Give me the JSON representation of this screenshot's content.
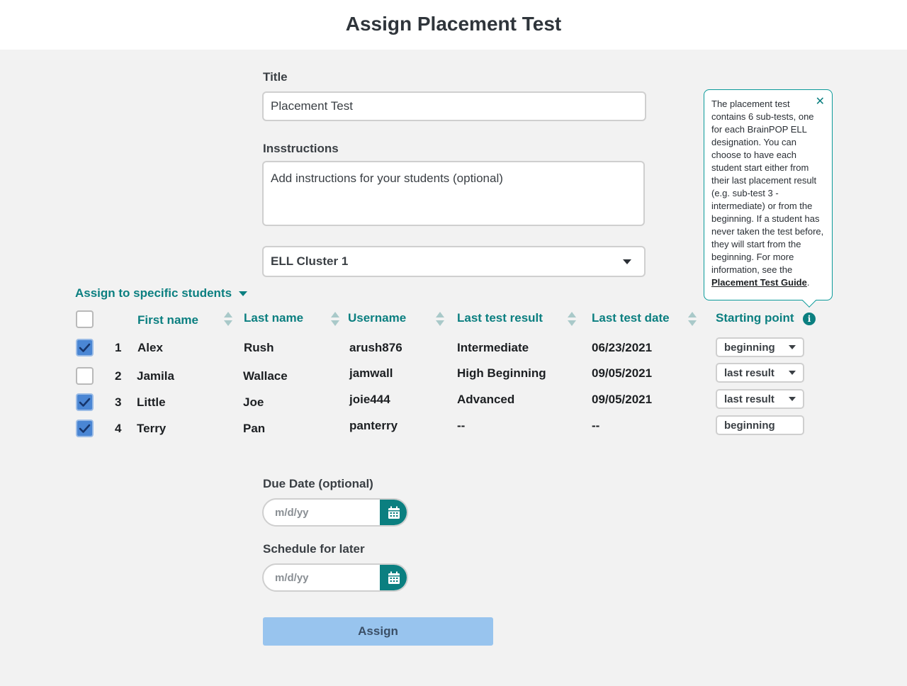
{
  "header": {
    "title": "Assign Placement Test"
  },
  "form": {
    "title_label": "Title",
    "title_value": "Placement Test",
    "instructions_label": "Insstructions",
    "instructions_placeholder": "Add instructions for your students (optional)",
    "cluster_value": "ELL Cluster 1"
  },
  "assign_toggle_label": "Assign to specific students",
  "table": {
    "headers": {
      "first_name": "First name",
      "last_name": "Last name",
      "username": "Username",
      "last_test_result": "Last test result",
      "last_test_date": "Last test date",
      "starting_point": "Starting point"
    },
    "rows": [
      {
        "index": "1",
        "checked": true,
        "first": "Alex",
        "last": "Rush",
        "username": "arush876",
        "result": "Intermediate",
        "date": "06/23/2021",
        "start": "beginning"
      },
      {
        "index": "2",
        "checked": false,
        "first": "Jamila",
        "last": "Wallace",
        "username": "jamwall",
        "result": "High Beginning",
        "date": "09/05/2021",
        "start": "last result"
      },
      {
        "index": "3",
        "checked": true,
        "first": "Little",
        "last": "Joe",
        "username": "joie444",
        "result": "Advanced",
        "date": "09/05/2021",
        "start": "last result"
      },
      {
        "index": "4",
        "checked": true,
        "first": "Terry",
        "last": "Pan",
        "username": "panterry",
        "result": "--",
        "date": "--",
        "start": "beginning"
      }
    ]
  },
  "tooltip": {
    "text": "The placement test contains 6 sub-tests, one for each BrainPOP ELL designation. You can choose to have each student start either from their last placement result (e.g. sub-test 3 - intermediate) or from the beginning. If a student has never taken the test before, they will start from the beginning. For more information, see the ",
    "link": "Placement Test Guide",
    "suffix": "."
  },
  "due_date": {
    "label": "Due Date (optional)",
    "placeholder": "m/d/yy"
  },
  "schedule": {
    "label": "Schedule for later",
    "placeholder": "m/d/yy"
  },
  "assign_button": "Assign",
  "colors": {
    "accent": "#0b7f80",
    "checkbox": "#4a86d4",
    "assign_button": "#98c4ee"
  }
}
